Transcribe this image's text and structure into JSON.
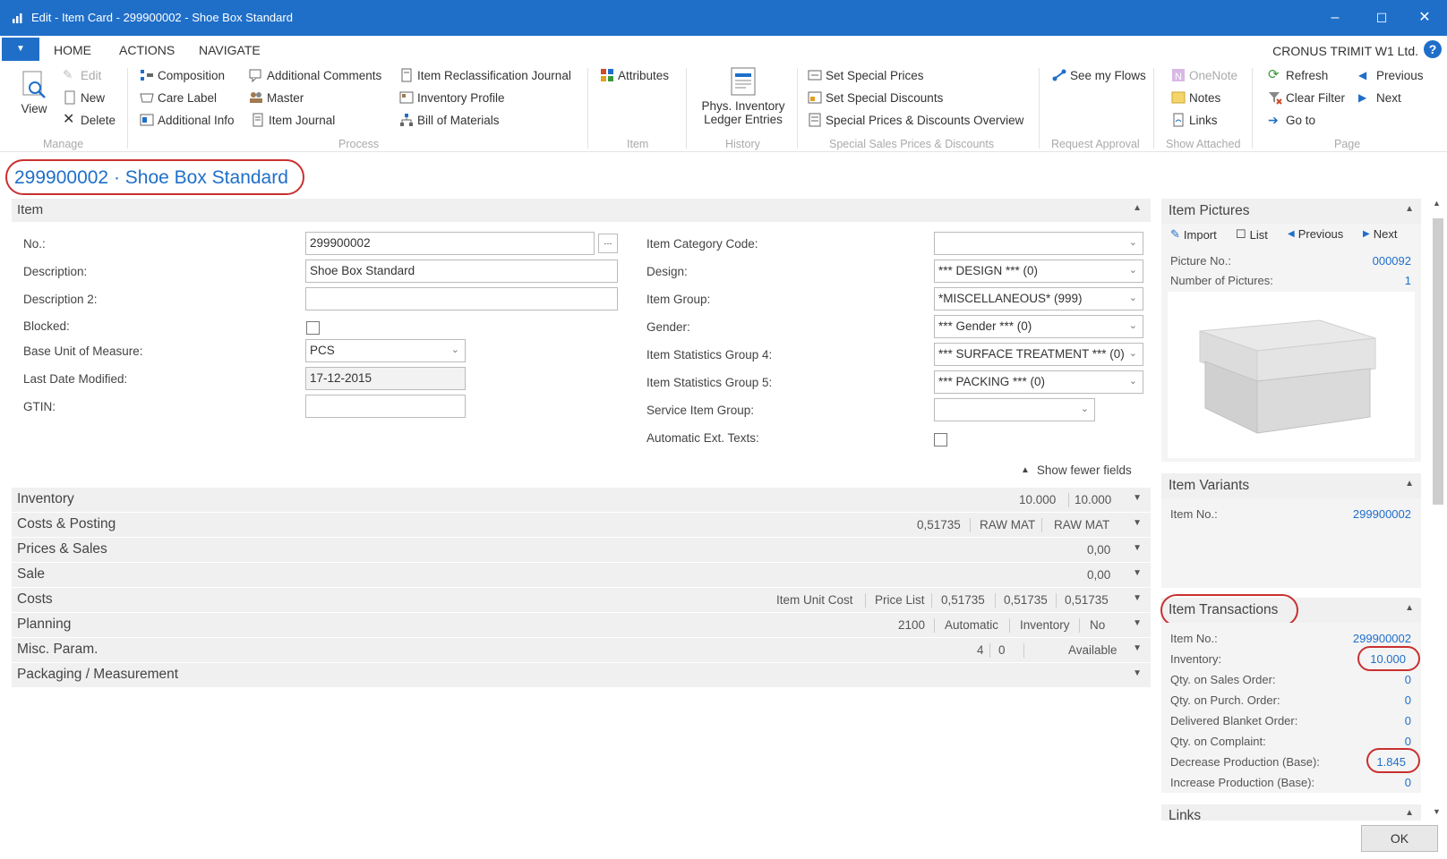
{
  "window": {
    "title": "Edit - Item Card - 299900002 - Shoe Box Standard"
  },
  "menu": {
    "tabs": [
      "HOME",
      "ACTIONS",
      "NAVIGATE"
    ],
    "company": "CRONUS TRIMIT W1 Ltd."
  },
  "ribbon": {
    "manage": {
      "view": "View",
      "edit": "Edit",
      "new": "New",
      "delete": "Delete",
      "label": "Manage"
    },
    "process": {
      "composition": "Composition",
      "care_label": "Care Label",
      "additional_info": "Additional Info",
      "additional_comments": "Additional Comments",
      "master": "Master",
      "item_journal": "Item Journal",
      "item_reclass_journal": "Item Reclassification Journal",
      "inventory_profile": "Inventory Profile",
      "bill_of_materials": "Bill of Materials",
      "label": "Process"
    },
    "item": {
      "attributes": "Attributes",
      "label": "Item"
    },
    "history": {
      "phys_inventory": "Phys. Inventory Ledger Entries",
      "label": "History"
    },
    "special": {
      "set_prices": "Set Special Prices",
      "set_discounts": "Set Special Discounts",
      "overview": "Special Prices & Discounts Overview",
      "label": "Special Sales Prices & Discounts"
    },
    "request": {
      "see_my_flows": "See my Flows",
      "label": "Request Approval"
    },
    "show_attached": {
      "onenote": "OneNote",
      "notes": "Notes",
      "links": "Links",
      "label": "Show Attached"
    },
    "page": {
      "refresh": "Refresh",
      "clear_filter": "Clear Filter",
      "go_to": "Go to",
      "previous": "Previous",
      "next": "Next",
      "label": "Page"
    }
  },
  "page_title": "299900002 · Shoe Box Standard",
  "item_section": {
    "header": "Item",
    "no_label": "No.:",
    "no_value": "299900002",
    "description_label": "Description:",
    "description_value": "Shoe Box Standard",
    "description2_label": "Description 2:",
    "description2_value": "",
    "blocked_label": "Blocked:",
    "base_uom_label": "Base Unit of Measure:",
    "base_uom_value": "PCS",
    "last_modified_label": "Last Date Modified:",
    "last_modified_value": "17-12-2015",
    "gtin_label": "GTIN:",
    "category_label": "Item Category Code:",
    "category_value": "",
    "design_label": "Design:",
    "design_value": "*** DESIGN *** (0)",
    "group_label": "Item Group:",
    "group_value": "*MISCELLANEOUS* (999)",
    "gender_label": "Gender:",
    "gender_value": "*** Gender *** (0)",
    "stat4_label": "Item Statistics Group 4:",
    "stat4_value": "*** SURFACE TREATMENT *** (0)",
    "stat5_label": "Item Statistics Group 5:",
    "stat5_value": "*** PACKING *** (0)",
    "service_label": "Service Item Group:",
    "service_value": "",
    "auto_ext_label": "Automatic Ext. Texts:",
    "show_fewer": "Show fewer fields"
  },
  "fasttabs": {
    "inventory": {
      "title": "Inventory",
      "v1": "10.000",
      "v2": "10.000"
    },
    "costs_posting": {
      "title": "Costs & Posting",
      "v1": "0,51735",
      "v2": "RAW MAT",
      "v3": "RAW MAT"
    },
    "prices_sales": {
      "title": "Prices & Sales",
      "v1": "0,00"
    },
    "sale": {
      "title": "Sale",
      "v1": "0,00"
    },
    "costs": {
      "title": "Costs",
      "v1": "Item Unit Cost",
      "v2": "Price List",
      "v3": "0,51735",
      "v4": "0,51735",
      "v5": "0,51735"
    },
    "planning": {
      "title": "Planning",
      "v1": "2100",
      "v2": "Automatic",
      "v3": "Inventory",
      "v4": "No"
    },
    "misc": {
      "title": "Misc. Param.",
      "v1": "4",
      "v2": "0",
      "v3": "Available"
    },
    "packaging": {
      "title": "Packaging / Measurement"
    }
  },
  "factbox": {
    "pictures": {
      "title": "Item Pictures",
      "import": "Import",
      "list": "List",
      "previous": "Previous",
      "next": "Next",
      "picture_no_label": "Picture No.:",
      "picture_no_value": "000092",
      "num_pictures_label": "Number of Pictures:",
      "num_pictures_value": "1"
    },
    "variants": {
      "title": "Item Variants",
      "item_no_label": "Item No.:",
      "item_no_value": "299900002"
    },
    "transactions": {
      "title": "Item Transactions",
      "rows": [
        {
          "label": "Item No.:",
          "value": "299900002"
        },
        {
          "label": "Inventory:",
          "value": "10.000"
        },
        {
          "label": "Qty. on Sales Order:",
          "value": "0"
        },
        {
          "label": "Qty. on Purch. Order:",
          "value": "0"
        },
        {
          "label": "Delivered Blanket Order:",
          "value": "0"
        },
        {
          "label": "Qty. on Complaint:",
          "value": "0"
        },
        {
          "label": "Decrease Production (Base):",
          "value": "1.845"
        },
        {
          "label": "Increase Production (Base):",
          "value": "0"
        }
      ]
    },
    "links": {
      "title": "Links"
    }
  },
  "ok_label": "OK",
  "colors": {
    "accent": "#1f6fc9",
    "highlight": "#c93030"
  }
}
